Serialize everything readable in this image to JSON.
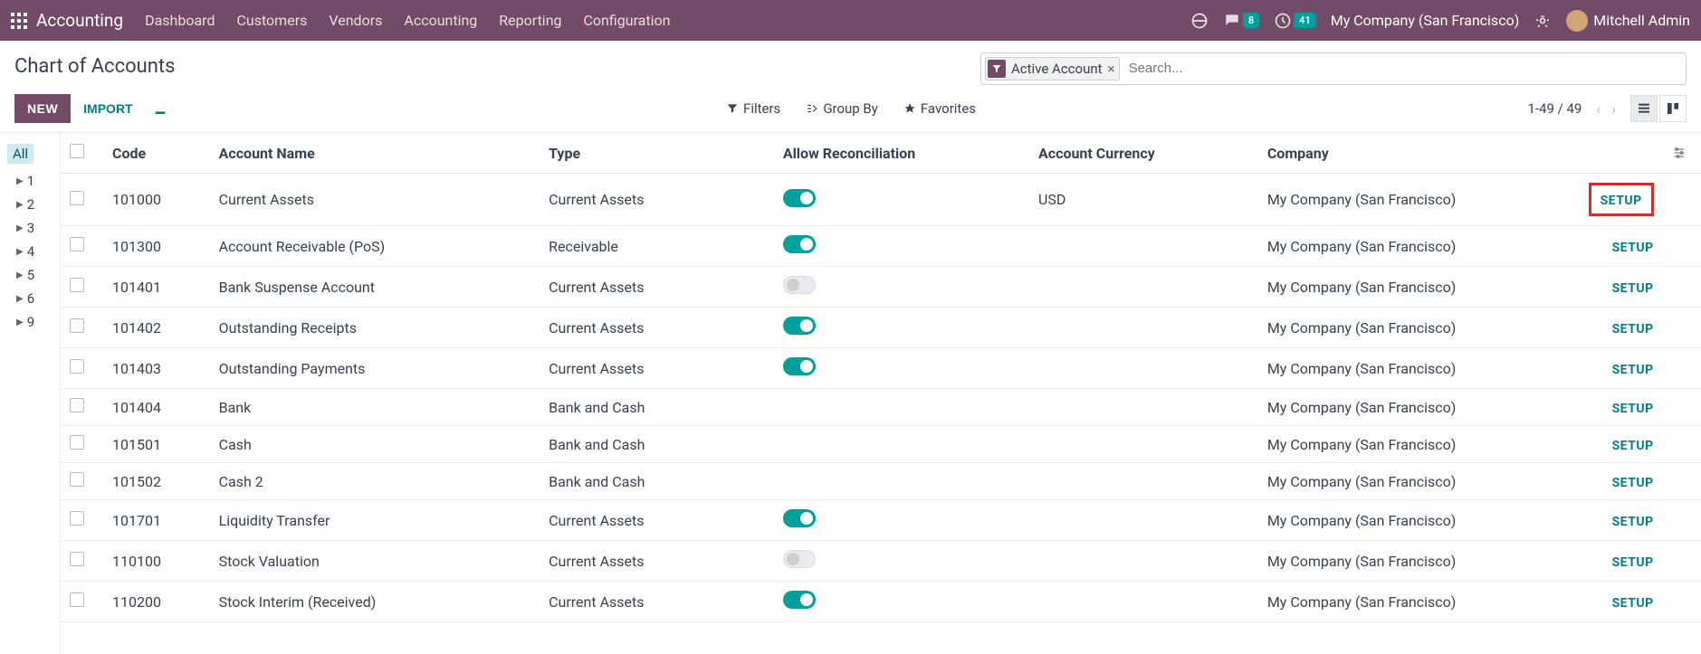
{
  "topnav": {
    "app_title": "Accounting",
    "menu": [
      "Dashboard",
      "Customers",
      "Vendors",
      "Accounting",
      "Reporting",
      "Configuration"
    ],
    "msg_badge": "8",
    "clock_badge": "41",
    "company": "My Company (San Francisco)",
    "user": "Mitchell Admin"
  },
  "breadcrumb": "Chart of Accounts",
  "buttons": {
    "new": "NEW",
    "import": "IMPORT"
  },
  "search": {
    "facet_label": "Active Account",
    "placeholder": "Search...",
    "filters": "Filters",
    "group_by": "Group By",
    "favorites": "Favorites"
  },
  "pager": {
    "text": "1-49 / 49"
  },
  "sidebar": {
    "all": "All",
    "tree": [
      "1",
      "2",
      "3",
      "4",
      "5",
      "6",
      "9"
    ]
  },
  "table": {
    "headers": {
      "code": "Code",
      "name": "Account Name",
      "type": "Type",
      "reconcile": "Allow Reconciliation",
      "currency": "Account Currency",
      "company": "Company"
    },
    "setup_label": "SETUP",
    "rows": [
      {
        "code": "101000",
        "name": "Current Assets",
        "type": "Current Assets",
        "reconcile": true,
        "currency": "USD",
        "company": "My Company (San Francisco)",
        "highlight": true
      },
      {
        "code": "101300",
        "name": "Account Receivable (PoS)",
        "type": "Receivable",
        "reconcile": true,
        "currency": "",
        "company": "My Company (San Francisco)"
      },
      {
        "code": "101401",
        "name": "Bank Suspense Account",
        "type": "Current Assets",
        "reconcile": false,
        "currency": "",
        "company": "My Company (San Francisco)"
      },
      {
        "code": "101402",
        "name": "Outstanding Receipts",
        "type": "Current Assets",
        "reconcile": true,
        "currency": "",
        "company": "My Company (San Francisco)"
      },
      {
        "code": "101403",
        "name": "Outstanding Payments",
        "type": "Current Assets",
        "reconcile": true,
        "currency": "",
        "company": "My Company (San Francisco)"
      },
      {
        "code": "101404",
        "name": "Bank",
        "type": "Bank and Cash",
        "reconcile": null,
        "currency": "",
        "company": "My Company (San Francisco)"
      },
      {
        "code": "101501",
        "name": "Cash",
        "type": "Bank and Cash",
        "reconcile": null,
        "currency": "",
        "company": "My Company (San Francisco)"
      },
      {
        "code": "101502",
        "name": "Cash 2",
        "type": "Bank and Cash",
        "reconcile": null,
        "currency": "",
        "company": "My Company (San Francisco)"
      },
      {
        "code": "101701",
        "name": "Liquidity Transfer",
        "type": "Current Assets",
        "reconcile": true,
        "currency": "",
        "company": "My Company (San Francisco)"
      },
      {
        "code": "110100",
        "name": "Stock Valuation",
        "type": "Current Assets",
        "reconcile": false,
        "currency": "",
        "company": "My Company (San Francisco)"
      },
      {
        "code": "110200",
        "name": "Stock Interim (Received)",
        "type": "Current Assets",
        "reconcile": true,
        "currency": "",
        "company": "My Company (San Francisco)"
      }
    ]
  }
}
